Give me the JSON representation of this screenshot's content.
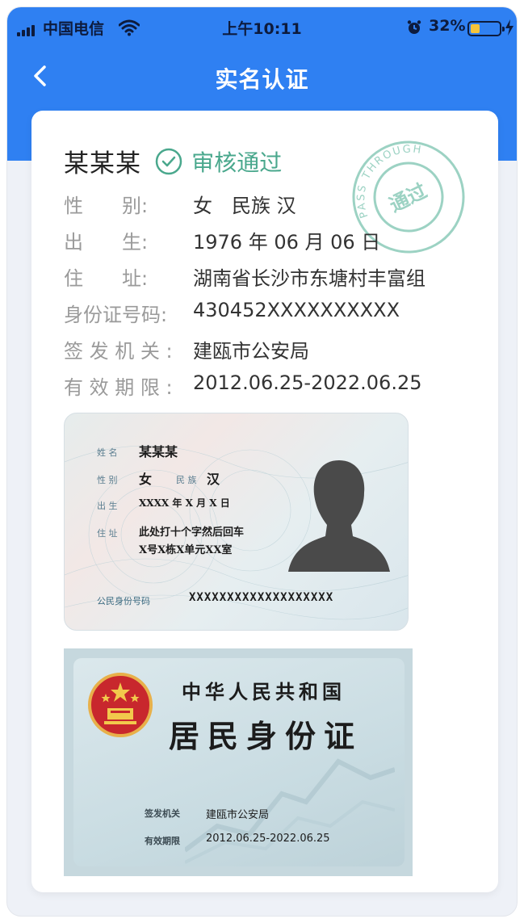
{
  "status_bar": {
    "carrier": "中国电信",
    "time": "上午10:11",
    "battery": "32%",
    "battery_level": 0.32
  },
  "nav": {
    "title": "实名认证"
  },
  "card": {
    "name": "某某某",
    "status": "审核通过",
    "stamp_outer": "PASS THROUGH",
    "stamp_inner": "通过",
    "fields": [
      {
        "label": "性　　别:",
        "value": "女　民族 汉"
      },
      {
        "label": "出　　生:",
        "value": "1976 年 06 月 06 日"
      },
      {
        "label": "住　　址:",
        "value": "湖南省长沙市东塘村丰富组"
      },
      {
        "label": "身份证号码:",
        "value": "430452XXXXXXXXXX"
      },
      {
        "label": "签 发 机 关 :",
        "value": "建瓯市公安局"
      },
      {
        "label": "有 效 期 限 :",
        "value": "2012.06.25-2022.06.25"
      }
    ]
  },
  "id_front": {
    "name_label": "姓 名",
    "name": "某某某",
    "gender_label": "性 别",
    "gender": "女",
    "ethnic_label": "民 族",
    "ethnic": "汉",
    "birth_label": "出 生",
    "birth": "XXXX 年 X 月 X 日",
    "addr_label": "住 址",
    "addr_line1": "此处打十个字然后回车",
    "addr_line2": "X号X栋X单元XX室",
    "id_label": "公民身份号码",
    "id_value": "XXXXXXXXXXXXXXXXXXX"
  },
  "id_back": {
    "country": "中华人民共和国",
    "title": "居民身份证",
    "authority_label": "签发机关",
    "authority": "建瓯市公安局",
    "validity_label": "有效期限",
    "validity": "2012.06.25-2022.06.25"
  }
}
